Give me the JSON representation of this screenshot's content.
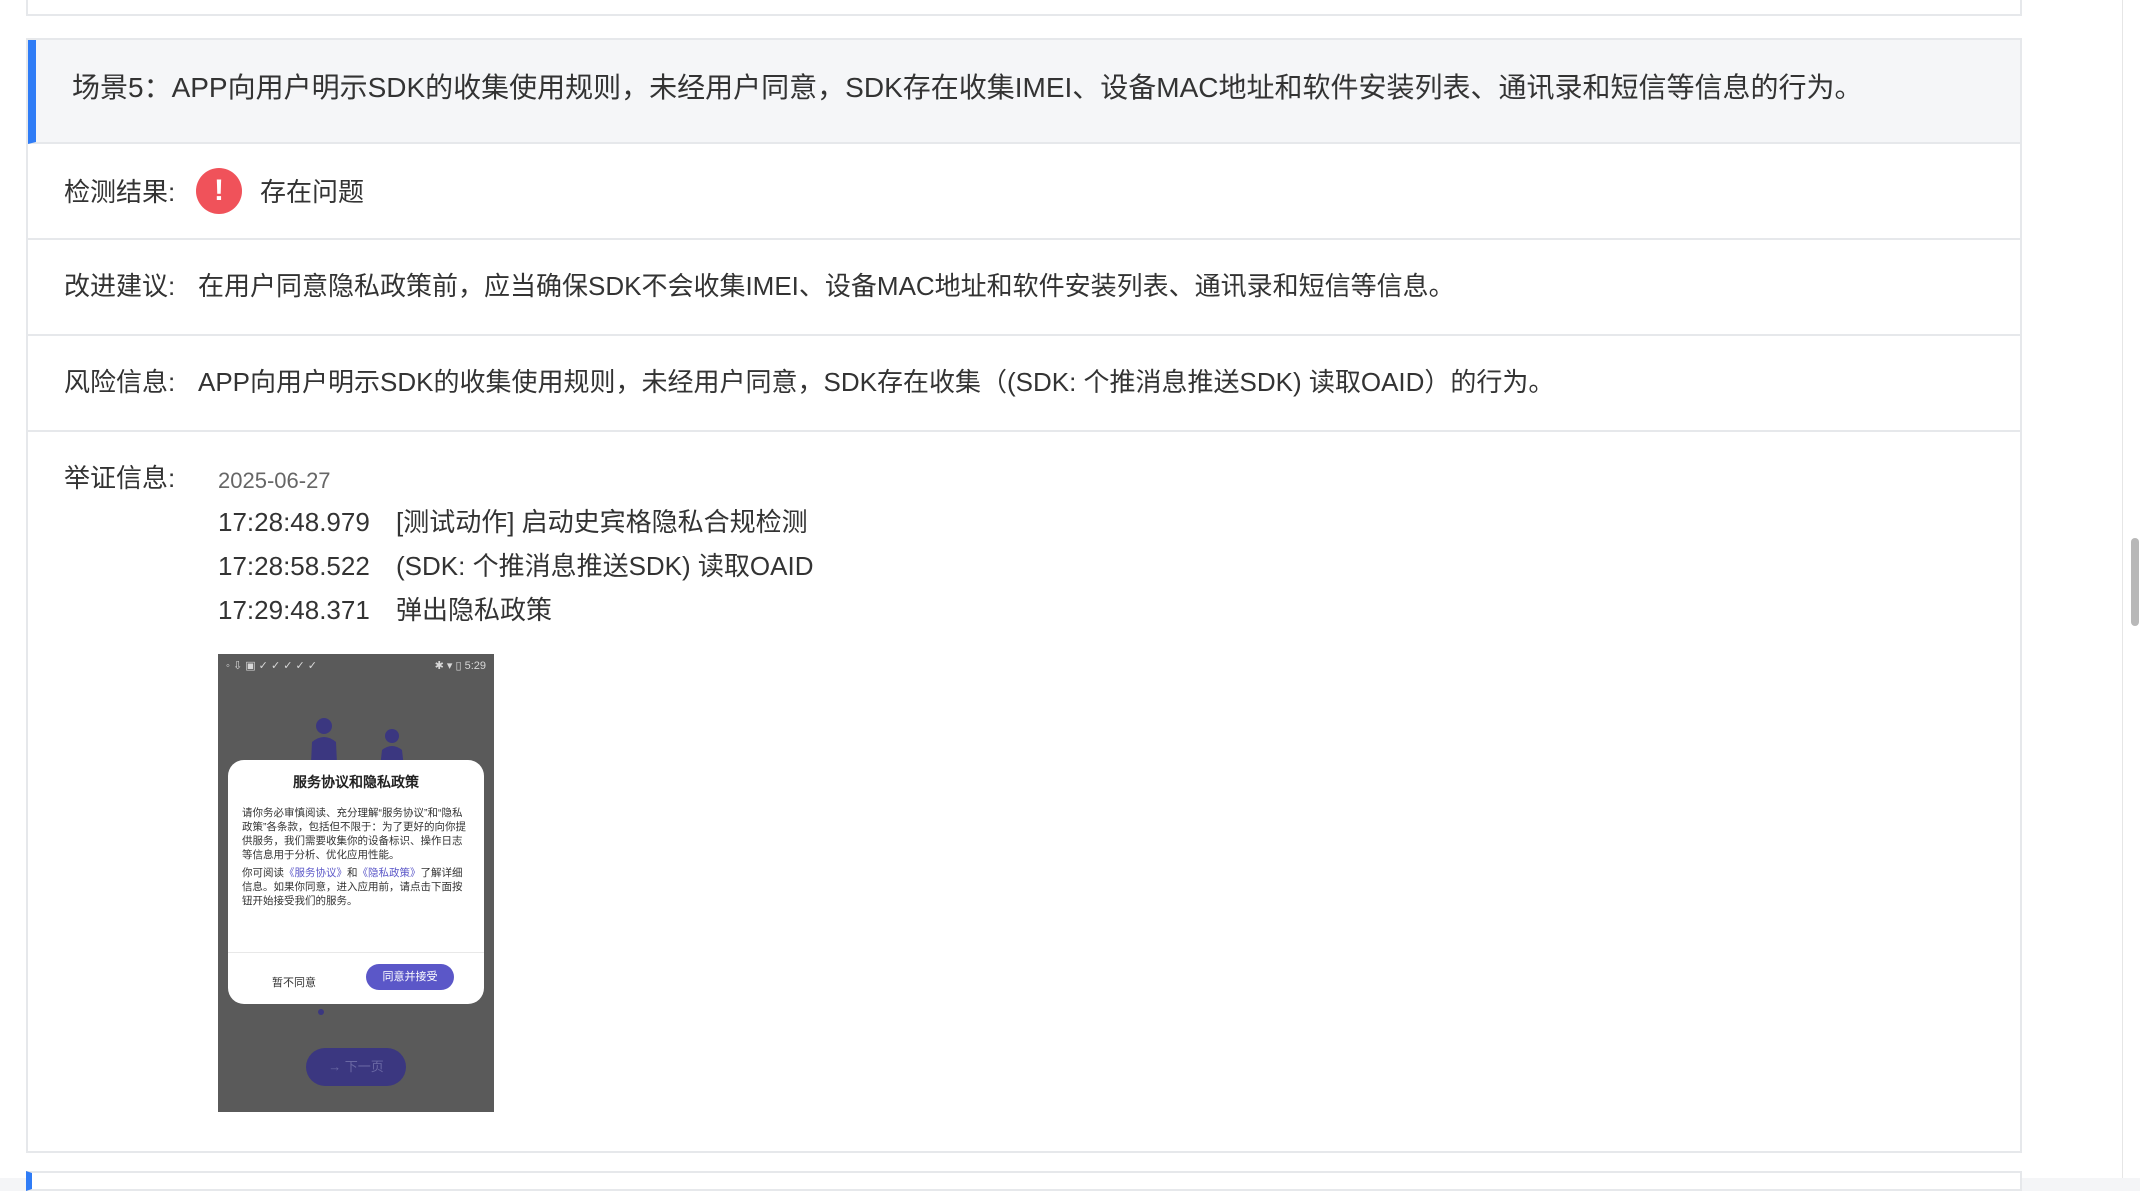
{
  "scene": {
    "title": "场景5：APP向用户明示SDK的收集使用规则，未经用户同意，SDK存在收集IMEI、设备MAC地址和软件安装列表、通讯录和短信等信息的行为。"
  },
  "result": {
    "label": "检测结果:",
    "value": "存在问题",
    "status_color": "#f0525a"
  },
  "suggestion": {
    "label": "改进建议:",
    "value": "在用户同意隐私政策前，应当确保SDK不会收集IMEI、设备MAC地址和软件安装列表、通讯录和短信等信息。"
  },
  "risk": {
    "label": "风险信息:",
    "value": "APP向用户明示SDK的收集使用规则，未经用户同意，SDK存在收集（(SDK: 个推消息推送SDK) 读取OAID）的行为。"
  },
  "evidence": {
    "label": "举证信息:",
    "date": "2025-06-27",
    "logs": [
      {
        "time": "17:28:48.979",
        "text": "[测试动作] 启动史宾格隐私合规检测"
      },
      {
        "time": "17:28:58.522",
        "text": "(SDK: 个推消息推送SDK) 读取OAID"
      },
      {
        "time": "17:29:48.371",
        "text": "弹出隐私政策"
      }
    ],
    "screenshot": {
      "status_time": "5:29",
      "dialog_title": "服务协议和隐私政策",
      "para1": "请你务必审慎阅读、充分理解“服务协议”和“隐私政策”各条款，包括但不限于：为了更好的向你提供服务，我们需要收集你的设备标识、操作日志等信息用于分析、优化应用性能。",
      "para2_prefix": "你可阅读",
      "link_service": "《服务协议》",
      "para2_and": "和",
      "link_privacy": "《隐私政策》",
      "para2_suffix": "了解详细信息。如果你同意，进入应用前，请点击下面按钮开始接受我们的服务。",
      "decline_label": "暂不同意",
      "accept_label": "同意并接受",
      "next_label": "→ 下一页",
      "accent_color": "#5b57c8"
    }
  }
}
